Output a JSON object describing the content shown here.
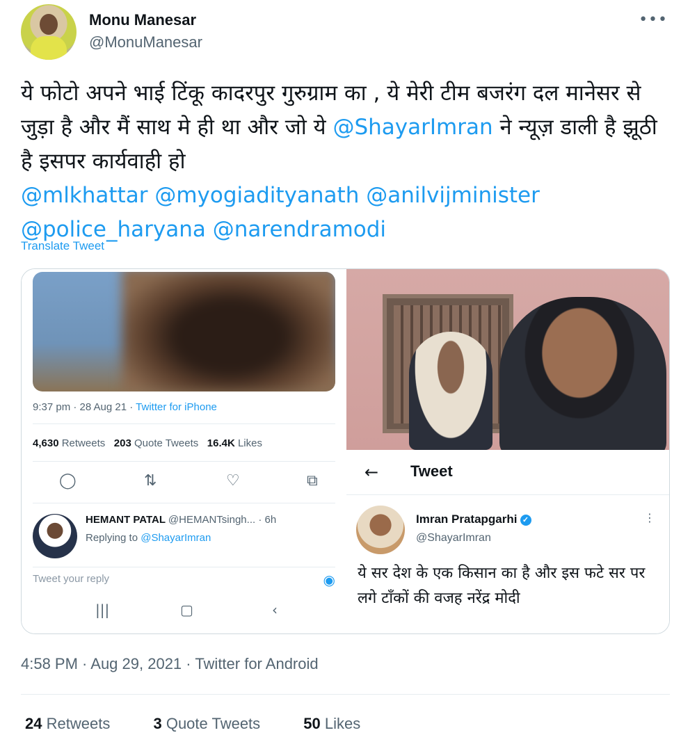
{
  "author": {
    "display_name": "Monu Manesar",
    "handle": "@MonuManesar"
  },
  "tweet": {
    "text_part1": "ये फोटो अपने भाई टिंकू कादरपुर गुरुग्राम का , ये मेरी टीम बजरंग दल मानेसर से जुड़ा है और मैं साथ मे ही था और जो ये ",
    "mention_shayar": "@ShayarImran",
    "text_part2": " ने न्यूज़ डाली है झूठी है इसपर  कार्यवाही हो",
    "mention_khattar": "@mlkhattar",
    "mention_yogi": "@myogiadityanath",
    "mention_vij": "@anilvijminister",
    "mention_police": "@police_haryana",
    "mention_modi": "@narendramodi",
    "translate": "Translate Tweet",
    "timestamp": "4:58 PM · Aug 29, 2021 · Twitter for Android"
  },
  "embedded_screenshot": {
    "meta_time": "9:37 pm · 28 Aug 21 · ",
    "meta_source": "Twitter for iPhone",
    "retweets_count": "4,630",
    "retweets_label": "Retweets",
    "quotes_count": "203",
    "quotes_label": "Quote Tweets",
    "likes_count": "16.4K",
    "likes_label": "Likes",
    "reply_name": "HEMANT PATAL",
    "reply_handle": "@HEMANTsingh...",
    "reply_time": "· 6h",
    "replying_to_label": "Replying to",
    "replying_to_mention": "@ShayarImran",
    "reply_placeholder": "Tweet your reply"
  },
  "quoted_tweet": {
    "header_title": "Tweet",
    "name": "Imran Pratapgarhi",
    "handle": "@ShayarImran",
    "text": "ये सर देश के एक किसान का है और इस फटे सर पर लगे टाँकों की वजह नरेंद्र मोदी"
  },
  "stats": {
    "retweets_count": "24",
    "retweets_label": "Retweets",
    "quotes_count": "3",
    "quotes_label": "Quote Tweets",
    "likes_count": "50",
    "likes_label": "Likes"
  },
  "icons": {
    "more": "more-icon",
    "reply": "reply-icon",
    "retweet": "retweet-icon",
    "like": "heart-icon",
    "share": "share-icon",
    "camera": "camera-icon",
    "back": "back-arrow-icon",
    "verified": "verified-icon"
  },
  "colors": {
    "accent": "#1d9bf0",
    "text": "#0f1419",
    "secondary": "#536471"
  }
}
